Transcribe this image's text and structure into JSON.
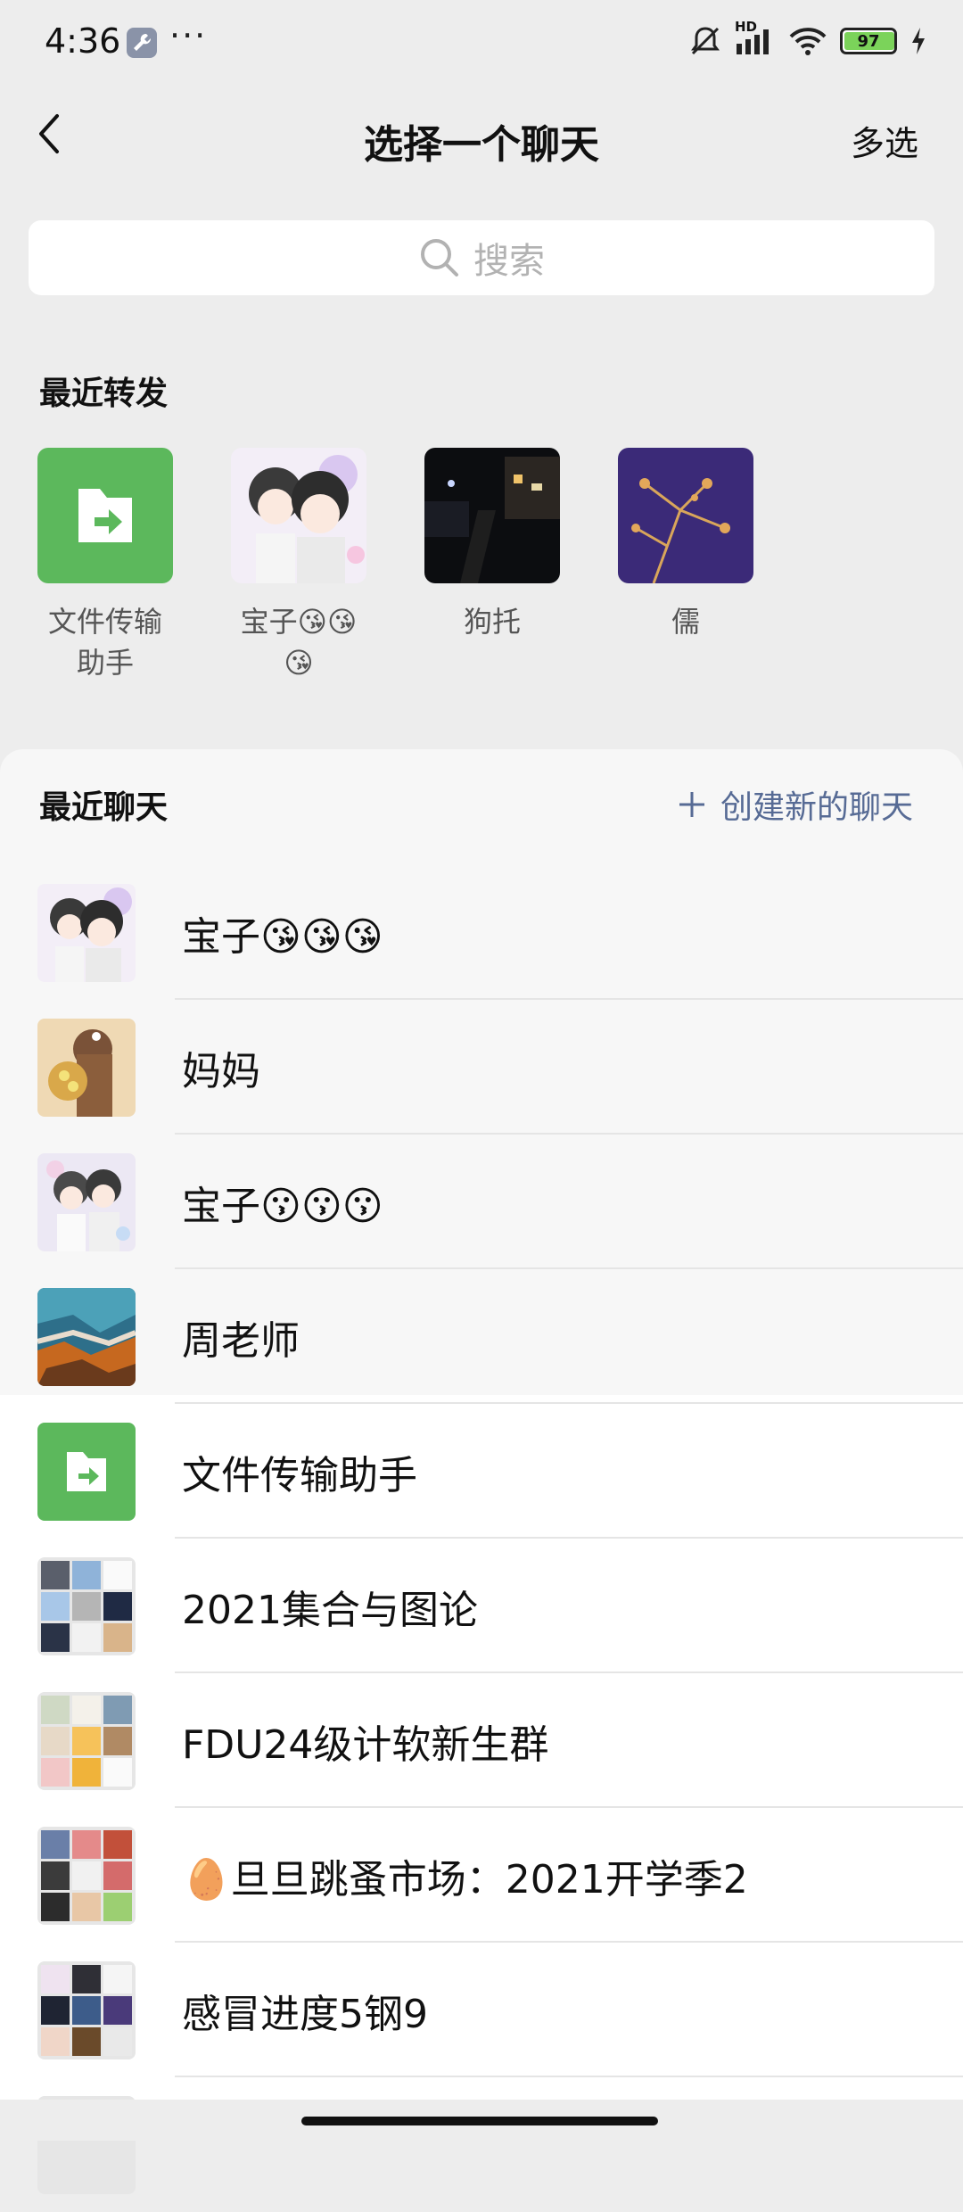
{
  "status_bar": {
    "time": "4:36",
    "more": "···",
    "network": "HD",
    "battery": "97",
    "battery_level": 0.97,
    "icons": [
      "wrench-icon",
      "mute-bell-icon",
      "signal-icon",
      "wifi-icon",
      "battery-icon",
      "charging-icon"
    ]
  },
  "header": {
    "title": "选择一个聊天",
    "multi_select": "多选"
  },
  "search": {
    "placeholder": "搜索"
  },
  "recent_forwards": {
    "title": "最近转发",
    "items": [
      {
        "label": "文件传输\n助手",
        "avatar": "file-transfer-icon"
      },
      {
        "label": "宝子😘😘\n😘",
        "avatar": "cartoon-couple-avatar"
      },
      {
        "label": "狗托",
        "avatar": "night-street-photo"
      },
      {
        "label": "儒",
        "avatar": "purple-tree-photo"
      }
    ]
  },
  "recent_chats": {
    "title": "最近聊天",
    "create_new": "创建新的聊天",
    "items": [
      {
        "name": "宝子😘😘😘",
        "avatar": "cartoon-couple-avatar"
      },
      {
        "name": "妈妈",
        "avatar": "girl-flowers-photo"
      },
      {
        "name": "宝子😗😗😗",
        "avatar": "cartoon-couple-avatar-2"
      },
      {
        "name": "周老师",
        "avatar": "aerial-landscape-photo"
      },
      {
        "name": "文件传输助手",
        "avatar": "file-transfer-icon"
      },
      {
        "name": "2021集合与图论",
        "avatar": "group-grid-avatar"
      },
      {
        "name": "FDU24级计软新生群",
        "avatar": "group-grid-avatar"
      },
      {
        "name": "🥚旦旦跳蚤市场：2021开学季2",
        "avatar": "group-grid-avatar"
      },
      {
        "name": "感冒进度5钢9",
        "avatar": "group-grid-avatar"
      }
    ]
  },
  "colors": {
    "background": "#ededed",
    "panel": "#f7f7f7",
    "accent_link": "#576b95",
    "file_green": "#5cb85c"
  }
}
